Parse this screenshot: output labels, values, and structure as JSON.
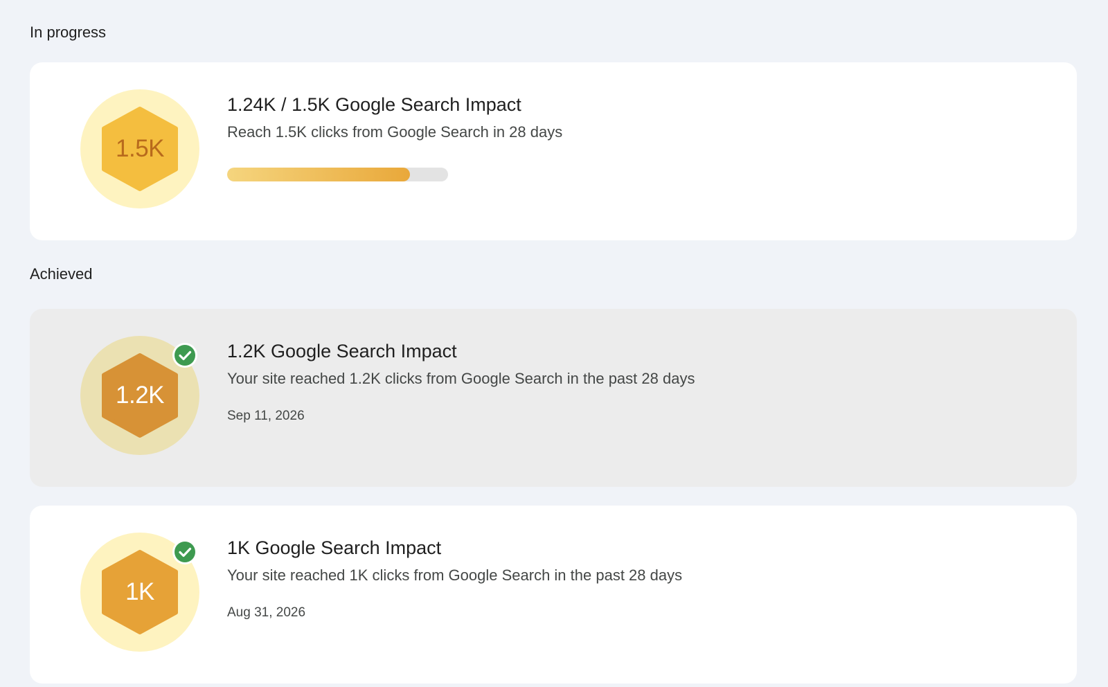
{
  "sections": {
    "in_progress": {
      "heading": "In progress",
      "card": {
        "badge_label": "1.5K",
        "title": "1.24K / 1.5K Google Search Impact",
        "description": "Reach 1.5K clicks from Google Search in 28 days",
        "progress_fraction": 0.827,
        "badge_icon": "hexagon-badge-icon",
        "colors": {
          "circle": "#fef3c0",
          "hexagon": "#f4be3f",
          "label": "#b86a1c"
        }
      }
    },
    "achieved": {
      "heading": "Achieved",
      "cards": [
        {
          "badge_label": "1.2K",
          "title": "1.2K Google Search Impact",
          "description": "Your site reached 1.2K clicks from Google Search in the past 28 days",
          "date": "Sep 11, 2026",
          "badge_icon": "hexagon-badge-icon",
          "status_icon": "check-circle-icon",
          "colors": {
            "card": "#ececec",
            "circle": "#ebe1b2",
            "hexagon": "#d79236",
            "label": "#ffffff",
            "check": "#3e9a50"
          }
        },
        {
          "badge_label": "1K",
          "title": "1K Google Search Impact",
          "description": "Your site reached 1K clicks from Google Search in the past 28 days",
          "date": "Aug 31, 2026",
          "badge_icon": "hexagon-badge-icon",
          "status_icon": "check-circle-icon",
          "colors": {
            "card": "#ffffff",
            "circle": "#fef3c0",
            "hexagon": "#e6a237",
            "label": "#ffffff",
            "check": "#3e9a50"
          }
        }
      ]
    }
  }
}
